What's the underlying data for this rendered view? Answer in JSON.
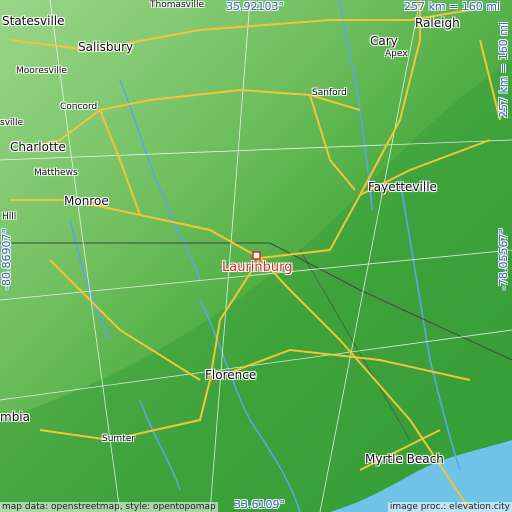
{
  "map": {
    "place": "Laurinburg",
    "marker_color": "#e0262a",
    "coords": {
      "top": "35.92103°",
      "bottom": "33.6109°",
      "left": "-80.86907°",
      "right": "-78.05567°"
    },
    "scale_top": "257 km = 160 mi",
    "scale_right": "257 km = 160 mi",
    "attribution_left": "map data: openstreetmap, style: opentopomap",
    "attribution_right": "image proc.: elevation.city",
    "cities": [
      {
        "id": "statesville",
        "label": "Statesville",
        "size": "normal"
      },
      {
        "id": "salisbury",
        "label": "Salisbury",
        "size": "normal"
      },
      {
        "id": "thomasville",
        "label": "Thomasville",
        "size": "small"
      },
      {
        "id": "mooresville",
        "label": "Mooresville",
        "size": "small"
      },
      {
        "id": "concord",
        "label": "Concord",
        "size": "small"
      },
      {
        "id": "charlotte",
        "label": "Charlotte",
        "size": "normal"
      },
      {
        "id": "matthews",
        "label": "Matthews",
        "size": "small"
      },
      {
        "id": "monroe",
        "label": "Monroe",
        "size": "normal"
      },
      {
        "id": "hill",
        "label": "Hill",
        "size": "small"
      },
      {
        "id": "raleigh",
        "label": "Raleigh",
        "size": "normal"
      },
      {
        "id": "cary",
        "label": "Cary",
        "size": "normal"
      },
      {
        "id": "apex",
        "label": "Apex",
        "size": "small"
      },
      {
        "id": "sanford",
        "label": "Sanford",
        "size": "small"
      },
      {
        "id": "fayetteville",
        "label": "Fayetteville",
        "size": "normal"
      },
      {
        "id": "florence",
        "label": "Florence",
        "size": "normal"
      },
      {
        "id": "sumter",
        "label": "Sumter",
        "size": "small"
      },
      {
        "id": "myrtle-beach",
        "label": "Myrtle Beach",
        "size": "normal"
      },
      {
        "id": "mbia",
        "label": "mbia",
        "size": "normal"
      },
      {
        "id": "sville",
        "label": "sville",
        "size": "small"
      }
    ],
    "colors": {
      "lowland": "#3ea33a",
      "upland": "#7fc86a",
      "ocean": "#6ec3e6",
      "road_major": "#f3c438",
      "road_minor": "#ffffff",
      "river": "#5aa6e6",
      "border": "#444444"
    }
  }
}
